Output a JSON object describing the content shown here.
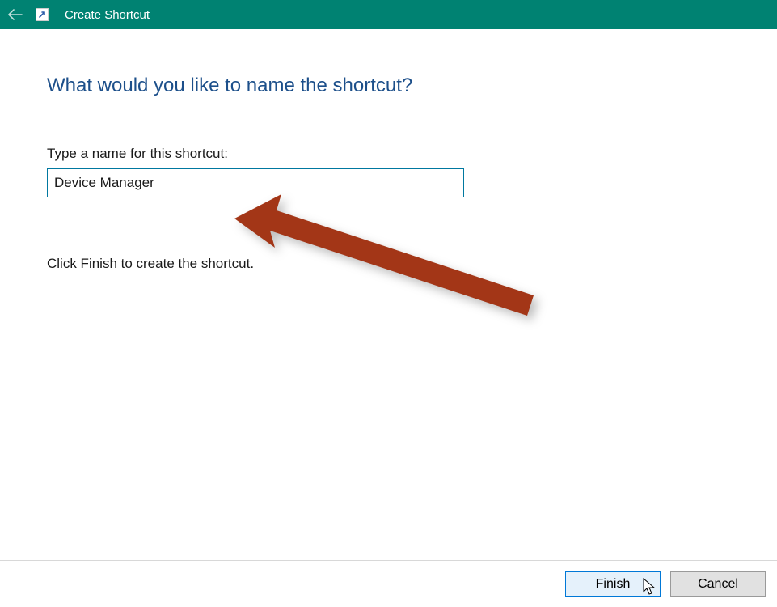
{
  "titlebar": {
    "title": "Create Shortcut"
  },
  "main": {
    "heading": "What would you like to name the shortcut?",
    "label": "Type a name for this shortcut:",
    "input_value": "Device Manager",
    "instruction": "Click Finish to create the shortcut."
  },
  "footer": {
    "finish_label": "Finish",
    "cancel_label": "Cancel"
  },
  "colors": {
    "titlebar_bg": "#008272",
    "heading_color": "#1c4f8a",
    "input_border": "#0078a0",
    "primary_btn_border": "#0078d7",
    "annotation_arrow": "#a33617"
  }
}
